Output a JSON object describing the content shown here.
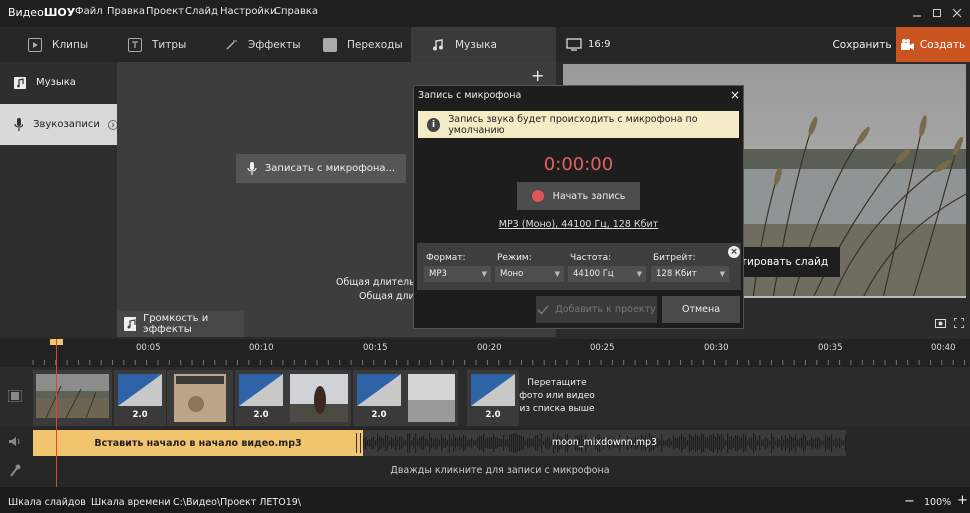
{
  "app": {
    "logo_part1": "Видео",
    "logo_part2": "ШОУ"
  },
  "menu": [
    "Файл",
    "Правка",
    "Проект",
    "Слайд",
    "Настройки",
    "Справка"
  ],
  "tabs": [
    "Клипы",
    "Титры",
    "Эффекты",
    "Переходы",
    "Музыка"
  ],
  "aspect": "16:9",
  "save_label": "Сохранить",
  "create_label": "Создать",
  "left_panel": [
    "Музыка",
    "Звукозаписи"
  ],
  "plus": "+",
  "record_mic_button": "Записать с микрофона...",
  "edit_slide": "Редактировать слайд",
  "total_duration_1": "Общая длительно",
  "total_duration_2": "Общая длите",
  "volume_button": "Громкость и эффекты",
  "dialog": {
    "title": "Запись с микрофона",
    "close": "×",
    "info": "Запись звука будет происходить с микрофона по умолчанию",
    "timer": "0:00:00",
    "start_button": "Начать запись",
    "format_link": "MP3 (Моно), 44100 Гц, 128 Кбит",
    "labels": {
      "format": "Формат:",
      "mode": "Режим:",
      "rate": "Частота:",
      "bitrate": "Битрейт:"
    },
    "values": {
      "format": "MP3",
      "mode": "Моно",
      "rate": "44100 Гц",
      "bitrate": "128 Кбит"
    },
    "add_button": "Добавить к проекту",
    "cancel_button": "Отмена"
  },
  "ruler": [
    "00:05",
    "00:10",
    "00:15",
    "00:20",
    "00:25",
    "00:30",
    "00:35",
    "00:40"
  ],
  "transition_duration": "2.0",
  "drag_hint": [
    "Перетащите",
    "фото или видео",
    "из списка выше"
  ],
  "audio_clip_1": "Вставить начало в начало видео.mp3",
  "audio_clip_2": "moon_mixdownn.mp3",
  "mic_hint": "Дважды кликните для записи с микрофона",
  "status": {
    "slides_scale": "Шкала слайдов",
    "time_scale": "Шкала времени",
    "path": "C:\\Видео\\Проект ЛЕТО19\\",
    "zoom": "100%"
  },
  "colors": {
    "accent": "#c9541f",
    "audio_clip": "#f2c46d",
    "timer": "#e06262",
    "info_bg": "#f4ecc6"
  }
}
